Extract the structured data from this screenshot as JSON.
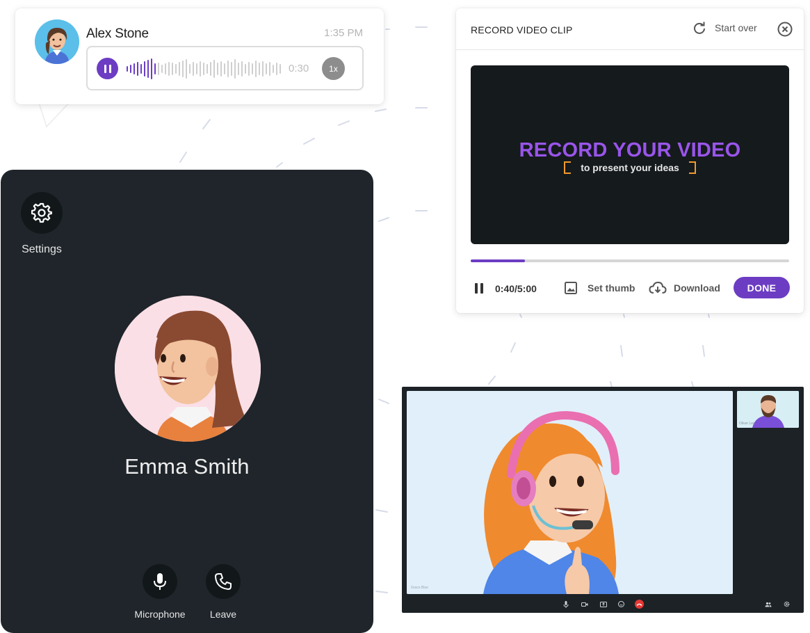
{
  "voice_message": {
    "sender": "Alex Stone",
    "time": "1:35 PM",
    "duration": "0:30",
    "speed": "1x",
    "played_fraction": 0.2
  },
  "record_clip": {
    "title": "RECORD VIDEO CLIP",
    "start_over": "Start over",
    "headline": "RECORD YOUR VIDEO",
    "subheadline": "to present your ideas",
    "progress_fraction": 0.17,
    "counter": "0:40/5:00",
    "set_thumb": "Set thumb",
    "download": "Download",
    "done": "DONE",
    "colors": {
      "accent": "#6c3dc3",
      "headline": "#9955ea",
      "bracket": "#f39a2d"
    }
  },
  "call": {
    "settings_label": "Settings",
    "participant_name": "Emma Smith",
    "microphone_label": "Microphone",
    "leave_label": "Leave"
  },
  "meeting": {
    "main_label": "Grace Blue",
    "thumb_label": "Oliver Lee",
    "end_call_color": "#e53935"
  }
}
